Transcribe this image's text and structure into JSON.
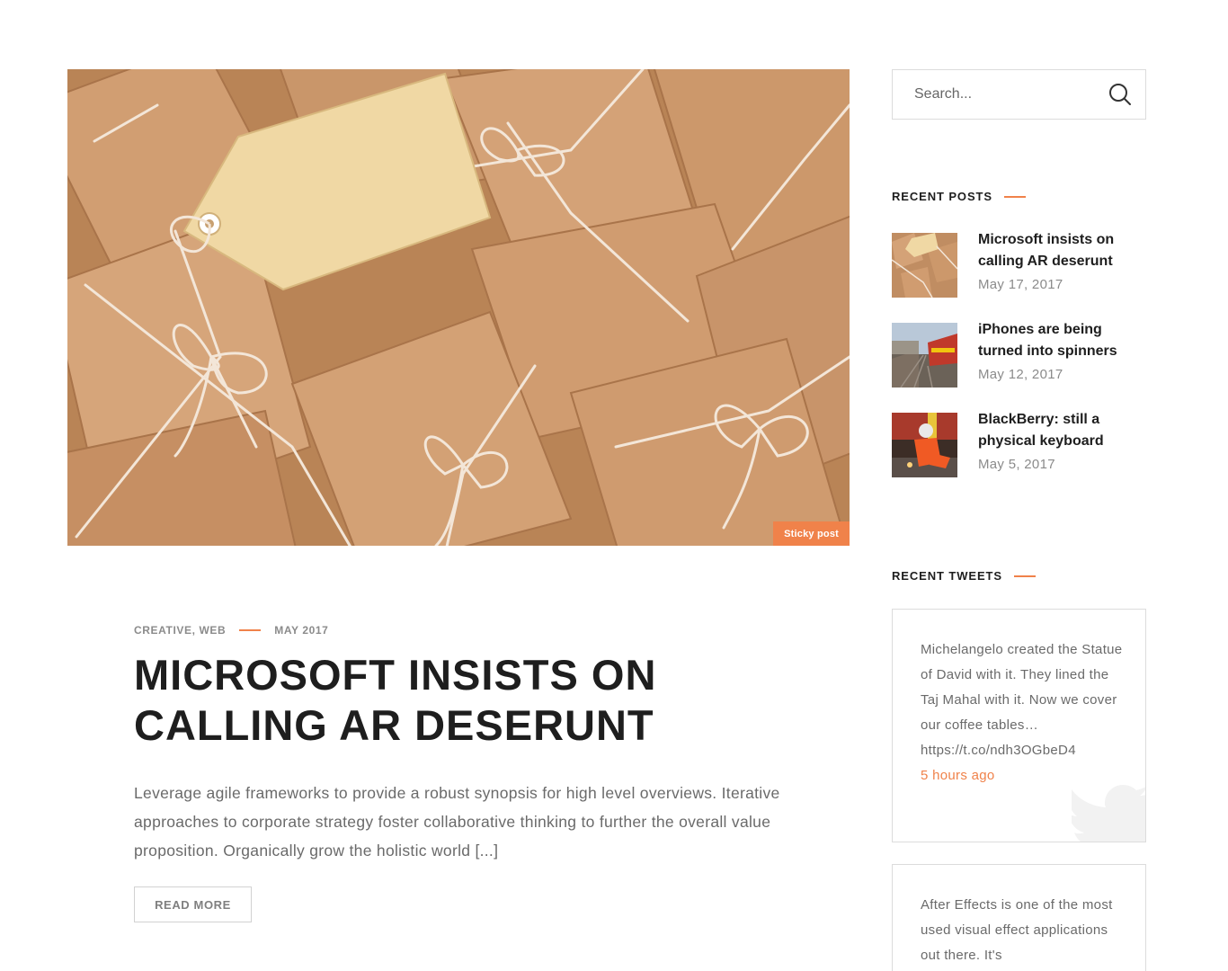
{
  "featured": {
    "image": "brown-paper-parcels-with-string-and-tag",
    "badge": "Sticky post"
  },
  "post": {
    "categories": "CREATIVE, WEB",
    "date": "MAY 2017",
    "title": "MICROSOFT INSISTS ON CALLING AR DESERUNT",
    "excerpt": "Leverage agile frameworks to provide a robust synopsis for high level overviews. Iterative approaches to corporate strategy foster collaborative thinking to further the overall value proposition. Organically grow the holistic world [...]",
    "read_more": "READ MORE"
  },
  "sidebar": {
    "search": {
      "placeholder": "Search..."
    },
    "recent_posts": {
      "title": "RECENT POSTS",
      "items": [
        {
          "title": "Microsoft insists on calling AR deserunt",
          "date": "May 17, 2017",
          "thumb": "parcels-thumbnail"
        },
        {
          "title": "iPhones are being turned into spinners",
          "date": "May 12, 2017",
          "thumb": "train-thumbnail"
        },
        {
          "title": "BlackBerry: still a physical keyboard",
          "date": "May 5, 2017",
          "thumb": "welder-thumbnail"
        }
      ]
    },
    "recent_tweets": {
      "title": "RECENT TWEETS",
      "items": [
        {
          "text": "Michelangelo created the Statue of David with it. They lined the Taj Mahal with it. Now we cover our coffee tables… https://t.co/ndh3OGbeD4",
          "time": "5 hours ago"
        },
        {
          "text": "After Effects is one of the most used visual effect applications out there. It's"
        }
      ]
    }
  },
  "colors": {
    "accent": "#f0824a",
    "text_dark": "#1e1e1e",
    "text_muted": "#8b8b8b",
    "border": "#dcdcdc"
  }
}
